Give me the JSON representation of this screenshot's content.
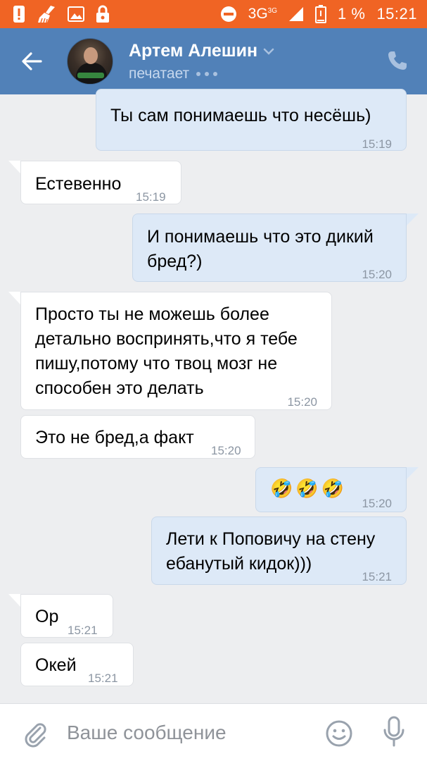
{
  "status_bar": {
    "network": "3G",
    "network_sup": "3G",
    "battery": "1 %",
    "time": "15:21",
    "bg_color": "#f06424"
  },
  "header": {
    "contact_name": "Артем Алешин",
    "status": "печатает",
    "bg_color": "#5181b8"
  },
  "messages": [
    {
      "dir": "out",
      "lines": [
        "Ты сам понимаешь что несёшь)"
      ],
      "time": "15:19"
    },
    {
      "dir": "in",
      "lines": [
        "Естевенно"
      ],
      "time": "15:19"
    },
    {
      "dir": "out",
      "lines": [
        "И понимаешь что это дикий",
        "бред?)"
      ],
      "time": "15:20"
    },
    {
      "dir": "in",
      "lines": [
        "Просто ты не можешь более",
        "детально воспринять,что я тебе",
        "пишу,потому что твоц мозг не",
        "способен это делать"
      ],
      "time": "15:20"
    },
    {
      "dir": "in",
      "lines": [
        "Это не бред,а факт"
      ],
      "time": "15:20"
    },
    {
      "dir": "out",
      "lines": [
        "🤣🤣🤣"
      ],
      "time": "15:20"
    },
    {
      "dir": "out",
      "lines": [
        "Лети к Поповичу на стену",
        "ебанутый кидок)))"
      ],
      "time": "15:21"
    },
    {
      "dir": "in",
      "lines": [
        "Ор"
      ],
      "time": "15:21"
    },
    {
      "dir": "in",
      "lines": [
        "Окей"
      ],
      "time": "15:21"
    }
  ],
  "input": {
    "placeholder": "Ваше сообщение"
  },
  "icons": {
    "attach": "paperclip-icon",
    "emoji": "smiley-icon",
    "mic": "microphone-icon",
    "back": "arrow-left-icon",
    "call": "phone-icon"
  }
}
